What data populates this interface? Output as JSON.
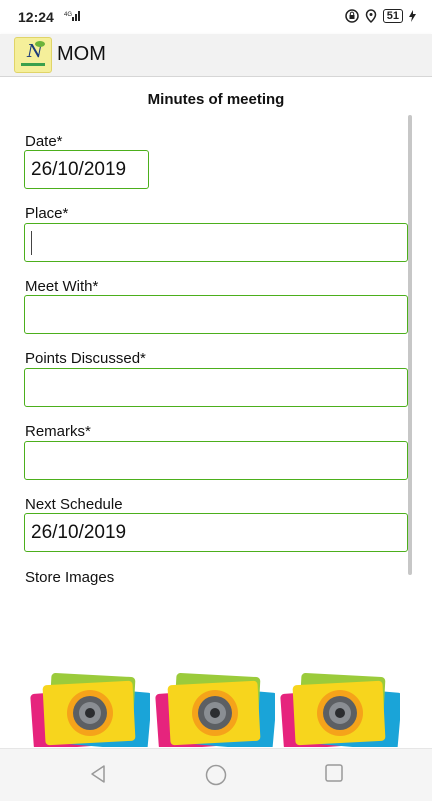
{
  "status_bar": {
    "time": "12:24",
    "battery": "51"
  },
  "app_bar": {
    "title": "MOM"
  },
  "form": {
    "heading": "Minutes of meeting",
    "date_label": "Date*",
    "date_value": "26/10/2019",
    "place_label": "Place*",
    "place_value": "",
    "meet_with_label": "Meet With*",
    "meet_with_value": "",
    "points_label": "Points Discussed*",
    "points_value": "",
    "remarks_label": "Remarks*",
    "remarks_value": "",
    "next_schedule_label": "Next Schedule",
    "next_schedule_value": "26/10/2019",
    "store_images_label": "Store Images"
  },
  "camera_buttons": [
    "camera-1",
    "camera-2",
    "camera-3"
  ],
  "colors": {
    "field_border": "#4caf1c",
    "app_bar_bg": "#f2f2f2"
  }
}
